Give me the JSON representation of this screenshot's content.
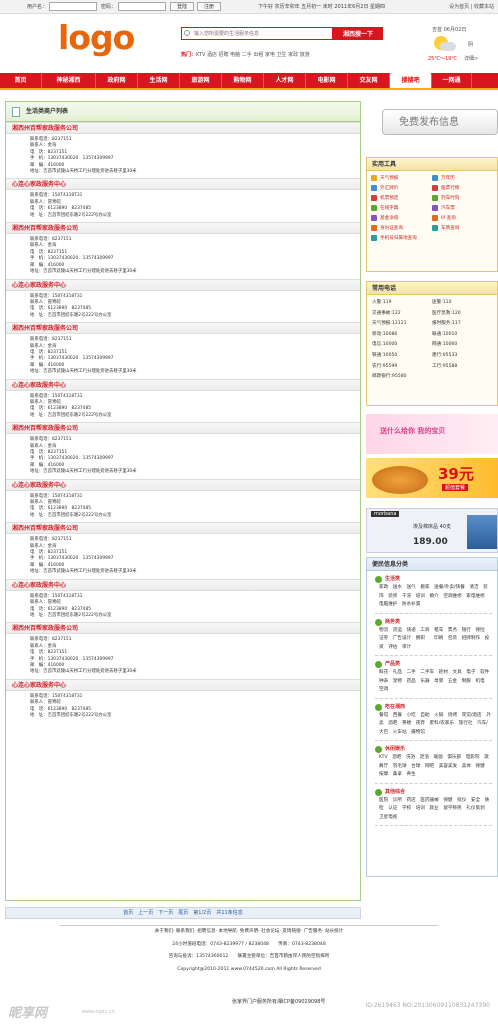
{
  "topbar": {
    "user_label": "用户名：",
    "pwd_label": "密码：",
    "login_btn": "登陆",
    "register_btn": "注册",
    "date_text": "下午好  农历辛卯年 五月初一 未时 2011年6月2日 星期四",
    "links": "设为首页 | 收藏本站"
  },
  "header": {
    "logo": "logo",
    "search_placeholder": "输入您所需要的生活服务信息",
    "search_btn": "湘西搜一下",
    "hot_label": "热门：",
    "hot_links": "KTV  酒店  招聘  电脑  二手  出租  家电  卫生  家政  旅游"
  },
  "weather": {
    "city_date": "吉首  06月02日",
    "cond": "阴",
    "temp": "25℃～19℃",
    "detail": "详细>"
  },
  "nav": [
    "首页",
    "神秘湘西",
    "政府网",
    "生活网",
    "旅游网",
    "购物网",
    "人才网",
    "电影网",
    "交友网",
    "搜搜吧",
    "一网通"
  ],
  "list_title": "生活类商户列表",
  "entries": [
    {
      "title": "湘西州百帮家政服务公司",
      "lines": [
        "联系电话：8237151",
        "联系人：金海",
        "电　话：8237151",
        "手　机：13037430020　13574309997",
        "邮　编：416000",
        "地址：吉首市武陵山天桥工行分理处旁进去巷子里30米"
      ]
    },
    {
      "title": "心连心家政服务中心",
      "lines": [
        "联系电话：150T4318T31",
        "联系人：冒胃皖",
        "电　话：6123890　8237485",
        "地　址：吉首市团结东路2号222号办公室"
      ]
    },
    {
      "title": "湘西州百帮家政服务公司",
      "lines": [
        "联系电话：8237151",
        "联系人：金海",
        "电　话：8237151",
        "手　机：13037430020　13574309997",
        "邮　编：416000",
        "地址：吉首市武陵山天桥工行分理处旁进去巷子里30米"
      ]
    },
    {
      "title": "心连心家政服务中心",
      "lines": [
        "联系电话：150T4318T31",
        "联系人：冒胃皖",
        "电　话：6123890　8237485",
        "地　址：吉首市团结东路2号222号办公室"
      ]
    },
    {
      "title": "湘西州百帮家政服务公司",
      "lines": [
        "联系电话：8237151",
        "联系人：金海",
        "电　话：8237151",
        "手　机：13037430020　13574309997",
        "邮　编：416000",
        "地址：吉首市武陵山天桥工行分理处旁进去巷子里30米"
      ]
    },
    {
      "title": "心连心家政服务中心",
      "lines": [
        "联系电话：150T4318T31",
        "联系人：冒胃皖",
        "电　话：6123890　8237485",
        "地　址：吉首市团结东路2号222号办公室"
      ]
    },
    {
      "title": "湘西州百帮家政服务公司",
      "lines": [
        "联系电话：8237151",
        "联系人：金海",
        "电　话：8237151",
        "手　机：13037430020　13574309997",
        "邮　编：416000",
        "地址：吉首市武陵山天桥工行分理处旁进去巷子里30米"
      ]
    },
    {
      "title": "心连心家政服务中心",
      "lines": [
        "联系电话：150T4318T31",
        "联系人：冒胃皖",
        "电　话：6123890　8237485",
        "地　址：吉首市团结东路2号222号办公室"
      ]
    },
    {
      "title": "湘西州百帮家政服务公司",
      "lines": [
        "联系电话：8237151",
        "联系人：金海",
        "电　话：8237151",
        "手　机：13037430020　13574309997",
        "邮　编：416000",
        "地址：吉首市武陵山天桥工行分理处旁进去巷子里30米"
      ]
    },
    {
      "title": "心连心家政服务中心",
      "lines": [
        "联系电话：150T4318T31",
        "联系人：冒胃皖",
        "电　话：6123890　8237485",
        "地　址：吉首市团结东路2号222号办公室"
      ]
    },
    {
      "title": "湘西州百帮家政服务公司",
      "lines": [
        "联系电话：8237151",
        "联系人：金海",
        "电　话：8237151",
        "手　机：13037430020　13574309997",
        "邮　编：416000",
        "地址：吉首市武陵山天桥工行分理处旁进去巷子里30米"
      ]
    },
    {
      "title": "心连心家政服务中心",
      "lines": [
        "联系电话：150T4318T31",
        "联系人：冒胃皖",
        "电　话：6123890　8237485",
        "地　址：吉首市团结东路2号222号办公室"
      ]
    }
  ],
  "pager": "首页　上一页　下一页　尾页　第1/2页　共11条信息",
  "right": {
    "free_btn": "免费发布信息",
    "tools_title": "实用工具",
    "tools": [
      [
        "天气预报",
        "万年历"
      ],
      [
        "外汇牌价",
        "股票行情"
      ],
      [
        "机票预定",
        "列车时刻"
      ],
      [
        "在线字典",
        "汽车票"
      ],
      [
        "基金净值",
        "IP 查询"
      ],
      [
        "身份证查询",
        "车牌查询"
      ],
      [
        "手机号归属地查询",
        ""
      ]
    ],
    "tool_colors": [
      "#e9a820",
      "#3d8ed8",
      "#d43d3d",
      "#5aa92a",
      "#8b4fc4",
      "#e26c1e",
      "#2a9d9d"
    ],
    "phones_title": "常用电话",
    "phones": [
      [
        "火警:119",
        "匪警:110"
      ],
      [
        "交通事故:122",
        "医疗急救:120"
      ],
      [
        "天气预报:12121",
        "报时服务:117"
      ],
      [
        "移动:10086",
        "联通:10010"
      ],
      [
        "电信:10000",
        "网通:10060"
      ],
      [
        "铁通:10050",
        "建行:95533"
      ],
      [
        "农行:95599",
        "工行:95588"
      ],
      [
        "邮政银行:95580",
        ""
      ]
    ],
    "ad1": "送什么给你   我的宝贝",
    "ad2": "39元",
    "ad2_sub": "超值套餐",
    "ad3_top": "morbana",
    "ad3_mid": "埃及棉床品 40支",
    "ad3_price": "189.00",
    "conv_title": "便民信息分类",
    "cats": [
      {
        "name": "生活类",
        "items": "家政　送水　送气　搬家　送餐/外卖/快餐　清洁　装饰　装修　干洗　培训　婚介　空调维修　家电维修　电脑维护　防水补漏"
      },
      {
        "name": "商务类",
        "items": "物流　货运　快递　工商　租车　票务　银行　保险　证券　广告设计　拥职　　印刷　包装　招牌制作　投资　评估　审计"
      },
      {
        "name": "产品类",
        "items": "鲜花　礼品　二手　二手车　耗材　文具　电子　软件　钟表　宠物　药品　乐器　母婴　五金　制服　机电　空调"
      },
      {
        "name": "吃在湘西",
        "items": "餐馆　西餐　小吃　自助　火锅　烧烤　宾馆/酒店　外卖　酒吧　茶楼　夜宵　废料/农家乐　旅行社　汽车/大巴　火车站　摄物馆"
      },
      {
        "name": "休闲娱乐",
        "items": "KTV　酒吧　洗浴　足浴　瑜伽　俱乐部　电影院　歌舞厅　羽毛球　台球　网吧　美容美发　美体　保健　按摩　桑拿　养生"
      },
      {
        "name": "其他综合",
        "items": "医院　诊所　药店　医药器械　保健　殡仪　安全　质检　认证　学校　培训　就业　留学移民　礼仪策划　卫星电视"
      }
    ]
  },
  "footer": {
    "line1": "关于我们· 联系我们· 招聘信息· 本地导航· 免费声明· 社会论坛· 友情链接· 广告服务· 站长统计",
    "line2": "24小时值班电话：0743-8239977 / 8238048　　传真：0743-8238048",
    "line3": "咨询与投诉：13574360012　　联署主管单位：吉首市鹤由岸人民防空指挥所",
    "line4": "Copyright@2010-2011 www.0744520.com All Rights Reserved",
    "line5": "张家界门户服务所有湘ICP备09029098号"
  },
  "watermark": {
    "site": "昵享网",
    "url": "www.nipic.cn",
    "ids": "ID:2619463 NO:20130609110831247390"
  }
}
